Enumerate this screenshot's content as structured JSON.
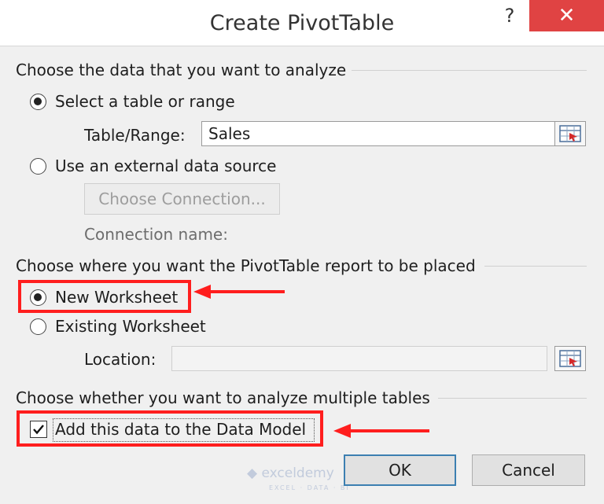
{
  "dialog": {
    "title": "Create PivotTable",
    "help_label": "?",
    "close_label": "✕"
  },
  "analyze_section": {
    "title": "Choose the data that you want to analyze",
    "select_table_label": "Select a table or range",
    "table_range_label": "Table/Range:",
    "table_range_value": "Sales",
    "external_source_label": "Use an external data source",
    "choose_connection_label": "Choose Connection...",
    "connection_name_label": "Connection name:"
  },
  "placement_section": {
    "title": "Choose where you want the PivotTable report to be placed",
    "new_worksheet_label": "New Worksheet",
    "existing_worksheet_label": "Existing Worksheet",
    "location_label": "Location:",
    "location_value": ""
  },
  "multiple_tables_section": {
    "title": "Choose whether you want to analyze multiple tables",
    "data_model_label": "Add this data to the Data Model"
  },
  "buttons": {
    "ok_label": "OK",
    "cancel_label": "Cancel"
  },
  "watermark": {
    "brand": "exceldemy",
    "tagline": "EXCEL · DATA · BI"
  },
  "colors": {
    "close_button": "#e04343",
    "highlight": "#ff1e1e",
    "default_button_border": "#3c7fb1"
  }
}
